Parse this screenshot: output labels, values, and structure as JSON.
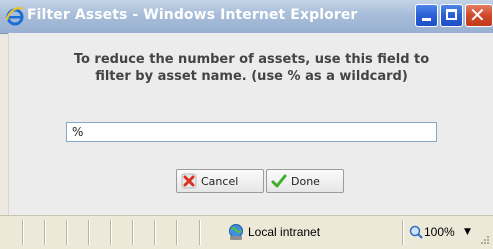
{
  "window": {
    "title": "Filter Assets - Windows Internet Explorer",
    "controls": {
      "minimize": "minimize",
      "maximize": "maximize",
      "close": "close"
    }
  },
  "dialog": {
    "message_line1": "To reduce the number of assets, use this field to",
    "message_line2": "filter by asset name. (use % as a wildcard)",
    "filter_value": "%",
    "cancel_label": "Cancel",
    "done_label": "Done"
  },
  "statusbar": {
    "zone": "Local intranet",
    "zoom": "100%"
  },
  "colors": {
    "title_gradient_top": "#c4d3e6",
    "close_button": "#d0492a",
    "control_buttons": "#2a5fd4",
    "content_bg": "#ececec",
    "message_text": "#444444",
    "input_border": "#8aa6cf"
  },
  "icons": {
    "app": "internet-explorer-icon",
    "cancel": "red-x-icon",
    "done": "green-checkmark-icon",
    "zone": "local-intranet-globe-icon",
    "zoom": "magnifier-icon"
  }
}
